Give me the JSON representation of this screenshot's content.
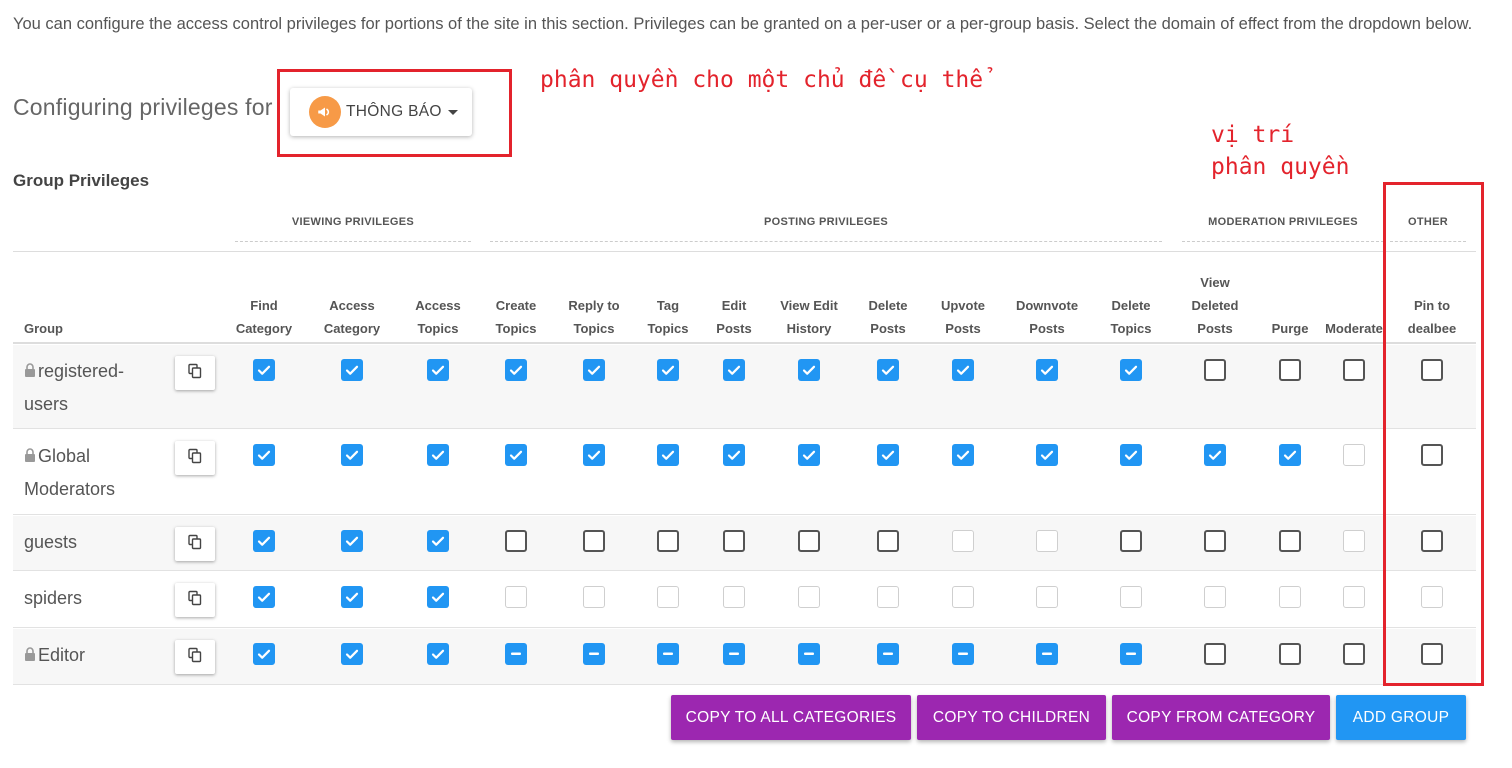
{
  "intro_text": "You can configure the access control privileges for portions of the site in this section. Privileges can be granted on a per-user or a per-group basis. Select the domain of effect from the dropdown below.",
  "configuring_label": "Configuring privileges for",
  "category": {
    "label": "THÔNG BÁO",
    "icon": "bullhorn-icon",
    "icon_color": "#f79a47"
  },
  "annotations": {
    "category_note": "phân quyền cho một chủ đề cụ thể",
    "position_note_line1": "vị trí",
    "position_note_line2": "phân quyền",
    "color": "#e3232c"
  },
  "section_title": "Group Privileges",
  "privilege_groups": [
    "VIEWING PRIVILEGES",
    "POSTING PRIVILEGES",
    "MODERATION PRIVILEGES",
    "OTHER"
  ],
  "group_column_label": "Group",
  "columns": [
    {
      "line1": "Find",
      "line2": "Category"
    },
    {
      "line1": "Access",
      "line2": "Category"
    },
    {
      "line1": "Access",
      "line2": "Topics"
    },
    {
      "line1": "Create",
      "line2": "Topics"
    },
    {
      "line1": "Reply to",
      "line2": "Topics"
    },
    {
      "line1": "Tag",
      "line2": "Topics"
    },
    {
      "line1": "Edit",
      "line2": "Posts"
    },
    {
      "line1": "View Edit",
      "line2": "History"
    },
    {
      "line1": "Delete",
      "line2": "Posts"
    },
    {
      "line1": "Upvote",
      "line2": "Posts"
    },
    {
      "line1": "Downvote",
      "line2": "Posts"
    },
    {
      "line1": "Delete",
      "line2": "Topics"
    },
    {
      "line0": "View",
      "line1": "Deleted",
      "line2": "Posts"
    },
    {
      "line1": "",
      "line2": "Purge"
    },
    {
      "line1": "",
      "line2": "Moderate"
    },
    {
      "line1": "Pin to",
      "line2": "dealbee"
    }
  ],
  "rows": [
    {
      "name_line1": "registered-",
      "name_line2": "users",
      "locked": true,
      "states": [
        "c",
        "c",
        "c",
        "c",
        "c",
        "c",
        "c",
        "c",
        "c",
        "c",
        "c",
        "c",
        "u",
        "u",
        "u",
        "u"
      ]
    },
    {
      "name_line1": "Global",
      "name_line2": "Moderators",
      "locked": true,
      "states": [
        "c",
        "c",
        "c",
        "c",
        "c",
        "c",
        "c",
        "c",
        "c",
        "c",
        "c",
        "c",
        "c",
        "c",
        "d",
        "u"
      ]
    },
    {
      "name_line1": "guests",
      "name_line2": "",
      "locked": false,
      "states": [
        "c",
        "c",
        "c",
        "u",
        "u",
        "u",
        "u",
        "u",
        "u",
        "d",
        "d",
        "u",
        "u",
        "u",
        "d",
        "u"
      ]
    },
    {
      "name_line1": "spiders",
      "name_line2": "",
      "locked": false,
      "states": [
        "c",
        "c",
        "c",
        "d",
        "d",
        "d",
        "d",
        "d",
        "d",
        "d",
        "d",
        "d",
        "d",
        "d",
        "d",
        "d"
      ]
    },
    {
      "name_line1": "Editor",
      "name_line2": "",
      "locked": true,
      "states": [
        "c",
        "c",
        "c",
        "i",
        "i",
        "i",
        "i",
        "i",
        "i",
        "i",
        "i",
        "i",
        "u",
        "u",
        "u",
        "u"
      ]
    }
  ],
  "buttons": {
    "copy_all": "COPY TO ALL CATEGORIES",
    "copy_children": "COPY TO CHILDREN",
    "copy_from": "COPY FROM CATEGORY",
    "add_group": "ADD GROUP"
  },
  "colors": {
    "accent_blue": "#2196f3",
    "purple": "#9c27b0",
    "annotation_red": "#e3232c"
  }
}
